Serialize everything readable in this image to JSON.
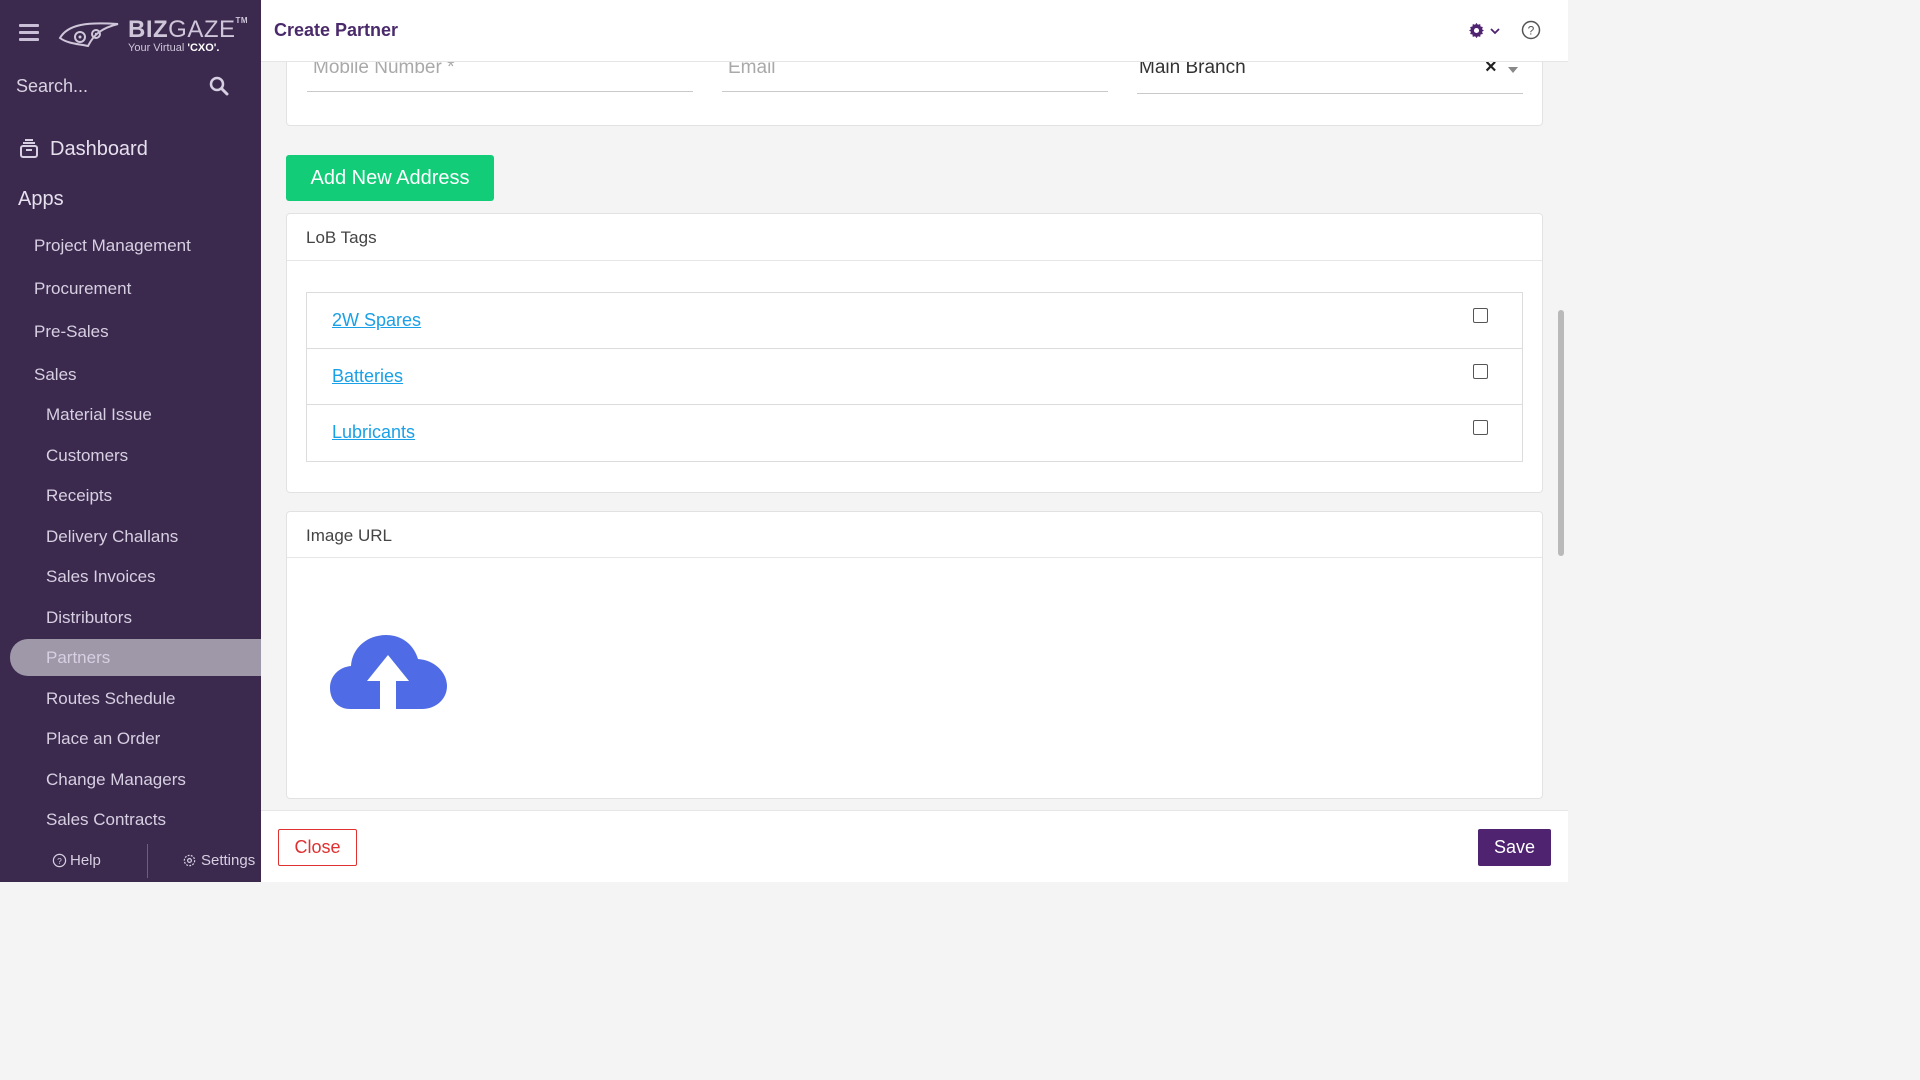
{
  "sidebar": {
    "logo": {
      "brand_bold": "BIZ",
      "brand_thin": "GAZE",
      "tm": "TM",
      "tagline_prefix": "Your Virtual ",
      "tagline_bold": "'CXO'."
    },
    "search_placeholder": "Search...",
    "dashboard_label": "Dashboard",
    "apps_label": "Apps",
    "items": [
      {
        "label": "Project Management"
      },
      {
        "label": "Procurement"
      },
      {
        "label": "Pre-Sales"
      },
      {
        "label": "Sales"
      },
      {
        "label": "Material Issue"
      },
      {
        "label": "Customers"
      },
      {
        "label": "Receipts"
      },
      {
        "label": "Delivery Challans"
      },
      {
        "label": "Sales Invoices"
      },
      {
        "label": "Distributors"
      },
      {
        "label": "Partners"
      },
      {
        "label": "Routes Schedule"
      },
      {
        "label": "Place an Order"
      },
      {
        "label": "Change Managers"
      },
      {
        "label": "Sales Contracts"
      }
    ],
    "active_item": "Partners",
    "footer": {
      "help_label": "Help",
      "settings_label": "Settings"
    }
  },
  "header": {
    "title": "Create Partner"
  },
  "form": {
    "mobile_placeholder": "Mobile Number *",
    "email_placeholder": "Email",
    "branch_value": "Main Branch",
    "clear_symbol": "×"
  },
  "add_address_label": "Add New Address",
  "lob_tags": {
    "title": "LoB Tags",
    "rows": [
      {
        "label": "2W Spares",
        "checked": false
      },
      {
        "label": "Batteries",
        "checked": false
      },
      {
        "label": "Lubricants",
        "checked": false
      }
    ]
  },
  "image_url": {
    "title": "Image URL"
  },
  "footer": {
    "close_label": "Close",
    "save_label": "Save"
  },
  "colors": {
    "sidebar_bg": "#3b2a4e",
    "accent_purple": "#4f2370",
    "add_button_green": "#12cc78",
    "link_blue": "#1aa0e6",
    "close_red": "#e03030",
    "upload_icon_blue": "#4f6be6"
  }
}
